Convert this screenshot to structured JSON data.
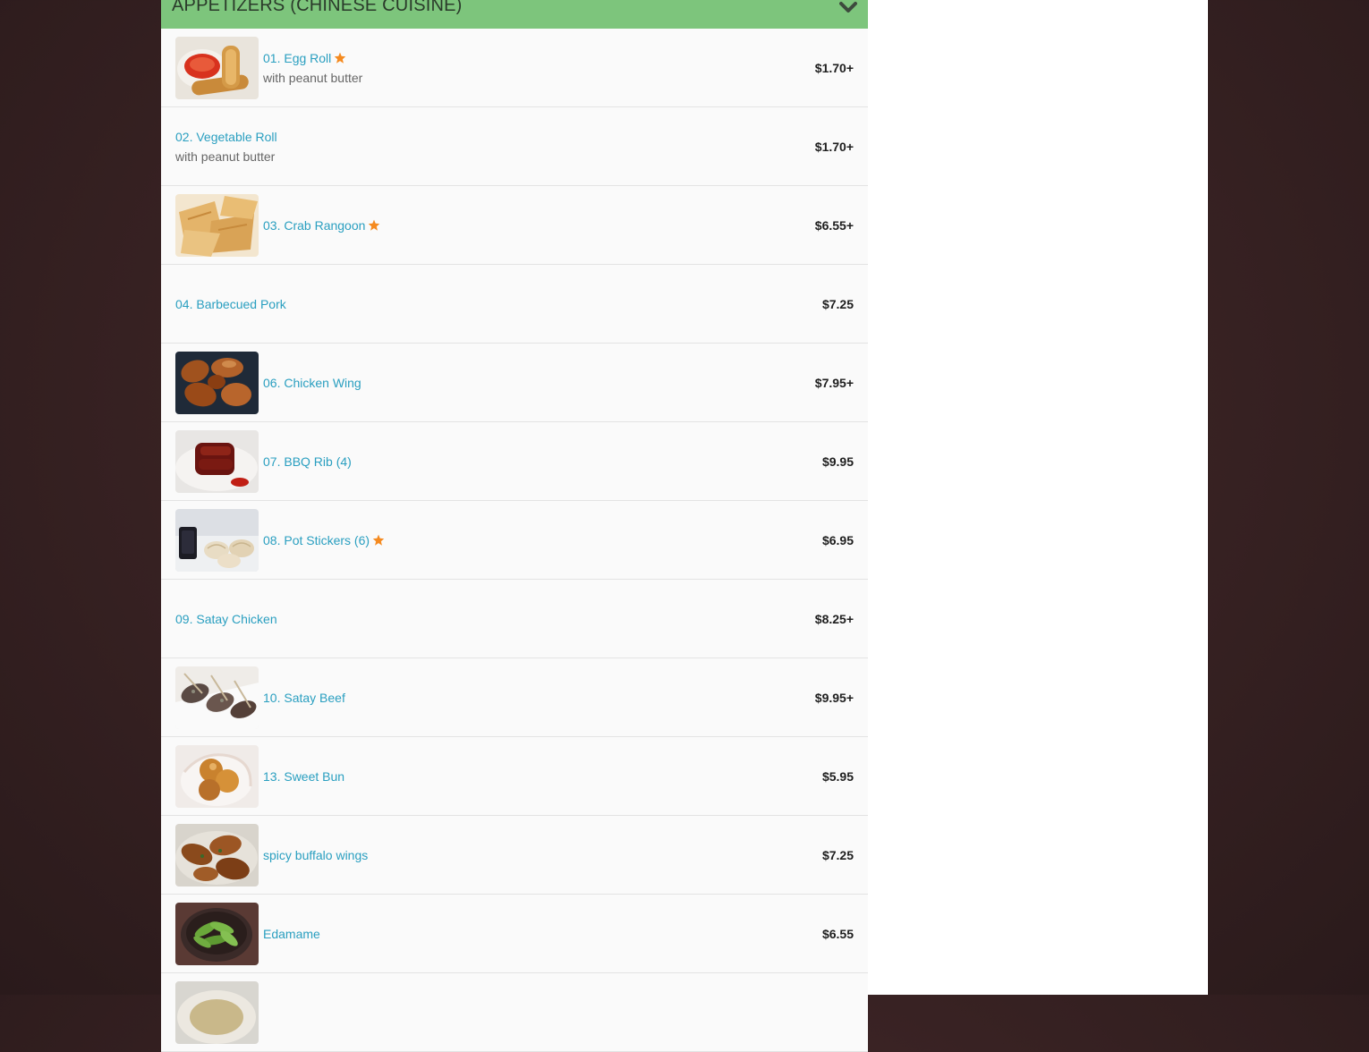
{
  "category": {
    "title": "APPETIZERS (CHINESE CUISINE)",
    "header_color": "#7dc57c",
    "toggle_icon": "chevron-down-icon"
  },
  "colors": {
    "link": "#2a9fc0",
    "popular_star": "#f58a1f",
    "price": "#1e1e1e"
  },
  "items": [
    {
      "name": "01. Egg Roll",
      "description": "with peanut butter",
      "price": "$1.70+",
      "popular": true
    },
    {
      "name": "02. Vegetable Roll",
      "description": "with peanut butter",
      "price": "$1.70+",
      "popular": false
    },
    {
      "name": "03. Crab Rangoon",
      "description": "",
      "price": "$6.55+",
      "popular": true
    },
    {
      "name": "04. Barbecued Pork",
      "description": "",
      "price": "$7.25",
      "popular": false
    },
    {
      "name": "06. Chicken Wing",
      "description": "",
      "price": "$7.95+",
      "popular": false
    },
    {
      "name": "07. BBQ Rib (4)",
      "description": "",
      "price": "$9.95",
      "popular": false
    },
    {
      "name": "08. Pot Stickers (6)",
      "description": "",
      "price": "$6.95",
      "popular": true
    },
    {
      "name": "09. Satay Chicken",
      "description": "",
      "price": "$8.25+",
      "popular": false
    },
    {
      "name": "10. Satay Beef",
      "description": "",
      "price": "$9.95+",
      "popular": false
    },
    {
      "name": "13. Sweet Bun",
      "description": "",
      "price": "$5.95",
      "popular": false
    },
    {
      "name": "spicy buffalo wings",
      "description": "",
      "price": "$7.25",
      "popular": false
    },
    {
      "name": "Edamame",
      "description": "",
      "price": "$6.55",
      "popular": false
    }
  ]
}
